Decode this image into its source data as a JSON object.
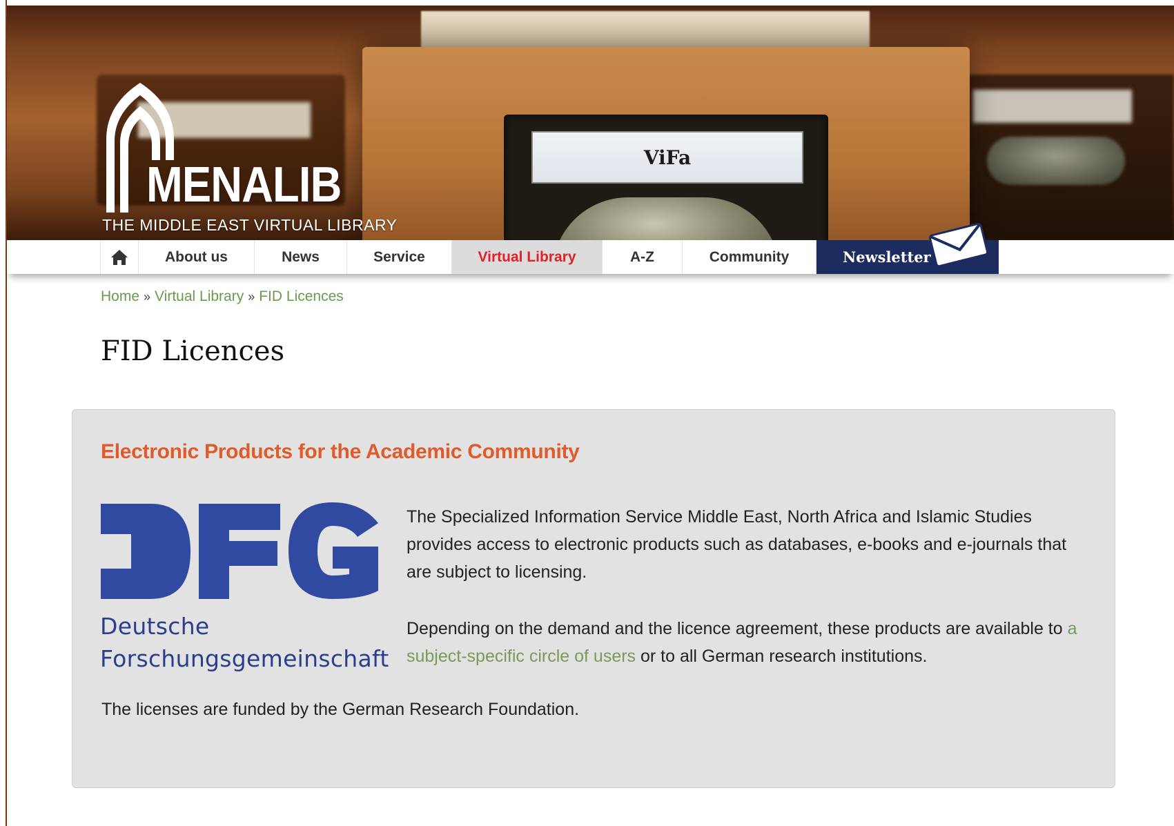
{
  "banner": {
    "card_label": "ViFa",
    "logo_name": "MENALIB",
    "logo_tagline": "THE MIDDLE EAST VIRTUAL LIBRARY"
  },
  "nav": {
    "home_icon": "home-icon",
    "about": "About us",
    "news": "News",
    "service": "Service",
    "virtual_library": "Virtual Library",
    "az": "A-Z",
    "community": "Community",
    "newsletter": "Newsletter",
    "newsletter_icon": "envelope-icon",
    "active": "Virtual Library",
    "active_color": "#e0202a",
    "newsletter_bg": "#1d2c5e"
  },
  "breadcrumb": {
    "home": "Home",
    "separator": "»",
    "virtual_library": "Virtual Library",
    "current": "FID Licences"
  },
  "page": {
    "title": "FID Licences"
  },
  "content": {
    "heading": "Electronic Products for the Academic Community",
    "heading_color": "#e05a2a",
    "logo": {
      "mark": "DFG",
      "line1": "Deutsche",
      "line2": "Forschungsgemeinschaft",
      "color": "#2f4aa0"
    },
    "paragraph1": "The Specialized Information Service Middle East, North Africa and Islamic Studies provides access to electronic products such as databases, e-books and e-journals that are subject to licensing.",
    "paragraph2_before": "Depending on the demand and the licence agreement, these products are available to ",
    "paragraph2_link": "a subject-specific circle of users",
    "paragraph2_after": " or to all German research institutions.",
    "paragraph3": "The licenses are funded by the German Research Foundation."
  }
}
